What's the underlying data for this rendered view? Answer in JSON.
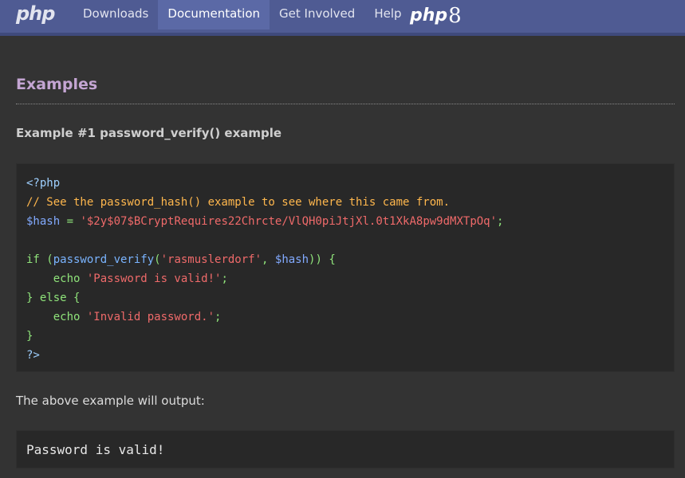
{
  "header": {
    "logo": "php",
    "nav": [
      {
        "label": "Downloads"
      },
      {
        "label": "Documentation",
        "active": true
      },
      {
        "label": "Get Involved"
      },
      {
        "label": "Help"
      }
    ],
    "php8_badge": {
      "text": "php",
      "number": "8"
    }
  },
  "section": {
    "title": "Examples",
    "example_title": "Example #1 password_verify() example"
  },
  "code": {
    "lines": [
      [
        {
          "t": "<?php",
          "c": "k"
        }
      ],
      [
        {
          "t": "// See the password_hash() example to see where this came from.",
          "c": "c"
        }
      ],
      [
        {
          "t": "$hash",
          "c": "v"
        },
        {
          "t": " = ",
          "c": "p"
        },
        {
          "t": "'$2y$07$BCryptRequires22Chrcte/VlQH0piJtjXl.0t1XkA8pw9dMXTpOq'",
          "c": "s"
        },
        {
          "t": ";",
          "c": "p"
        }
      ],
      [],
      [
        {
          "t": "if (",
          "c": "kw"
        },
        {
          "t": "password_verify",
          "c": "fn"
        },
        {
          "t": "(",
          "c": "p"
        },
        {
          "t": "'rasmuslerdorf'",
          "c": "s"
        },
        {
          "t": ", ",
          "c": "p"
        },
        {
          "t": "$hash",
          "c": "v"
        },
        {
          "t": ")) {",
          "c": "p"
        }
      ],
      [
        {
          "t": "    echo ",
          "c": "kw"
        },
        {
          "t": "'Password is valid!'",
          "c": "s"
        },
        {
          "t": ";",
          "c": "p"
        }
      ],
      [
        {
          "t": "} else {",
          "c": "kw"
        }
      ],
      [
        {
          "t": "    echo ",
          "c": "kw"
        },
        {
          "t": "'Invalid password.'",
          "c": "s"
        },
        {
          "t": ";",
          "c": "p"
        }
      ],
      [
        {
          "t": "}",
          "c": "kw"
        }
      ],
      [
        {
          "t": "?>",
          "c": "k"
        }
      ]
    ]
  },
  "output": {
    "label": "The above example will output:",
    "text": "Password is valid!"
  }
}
